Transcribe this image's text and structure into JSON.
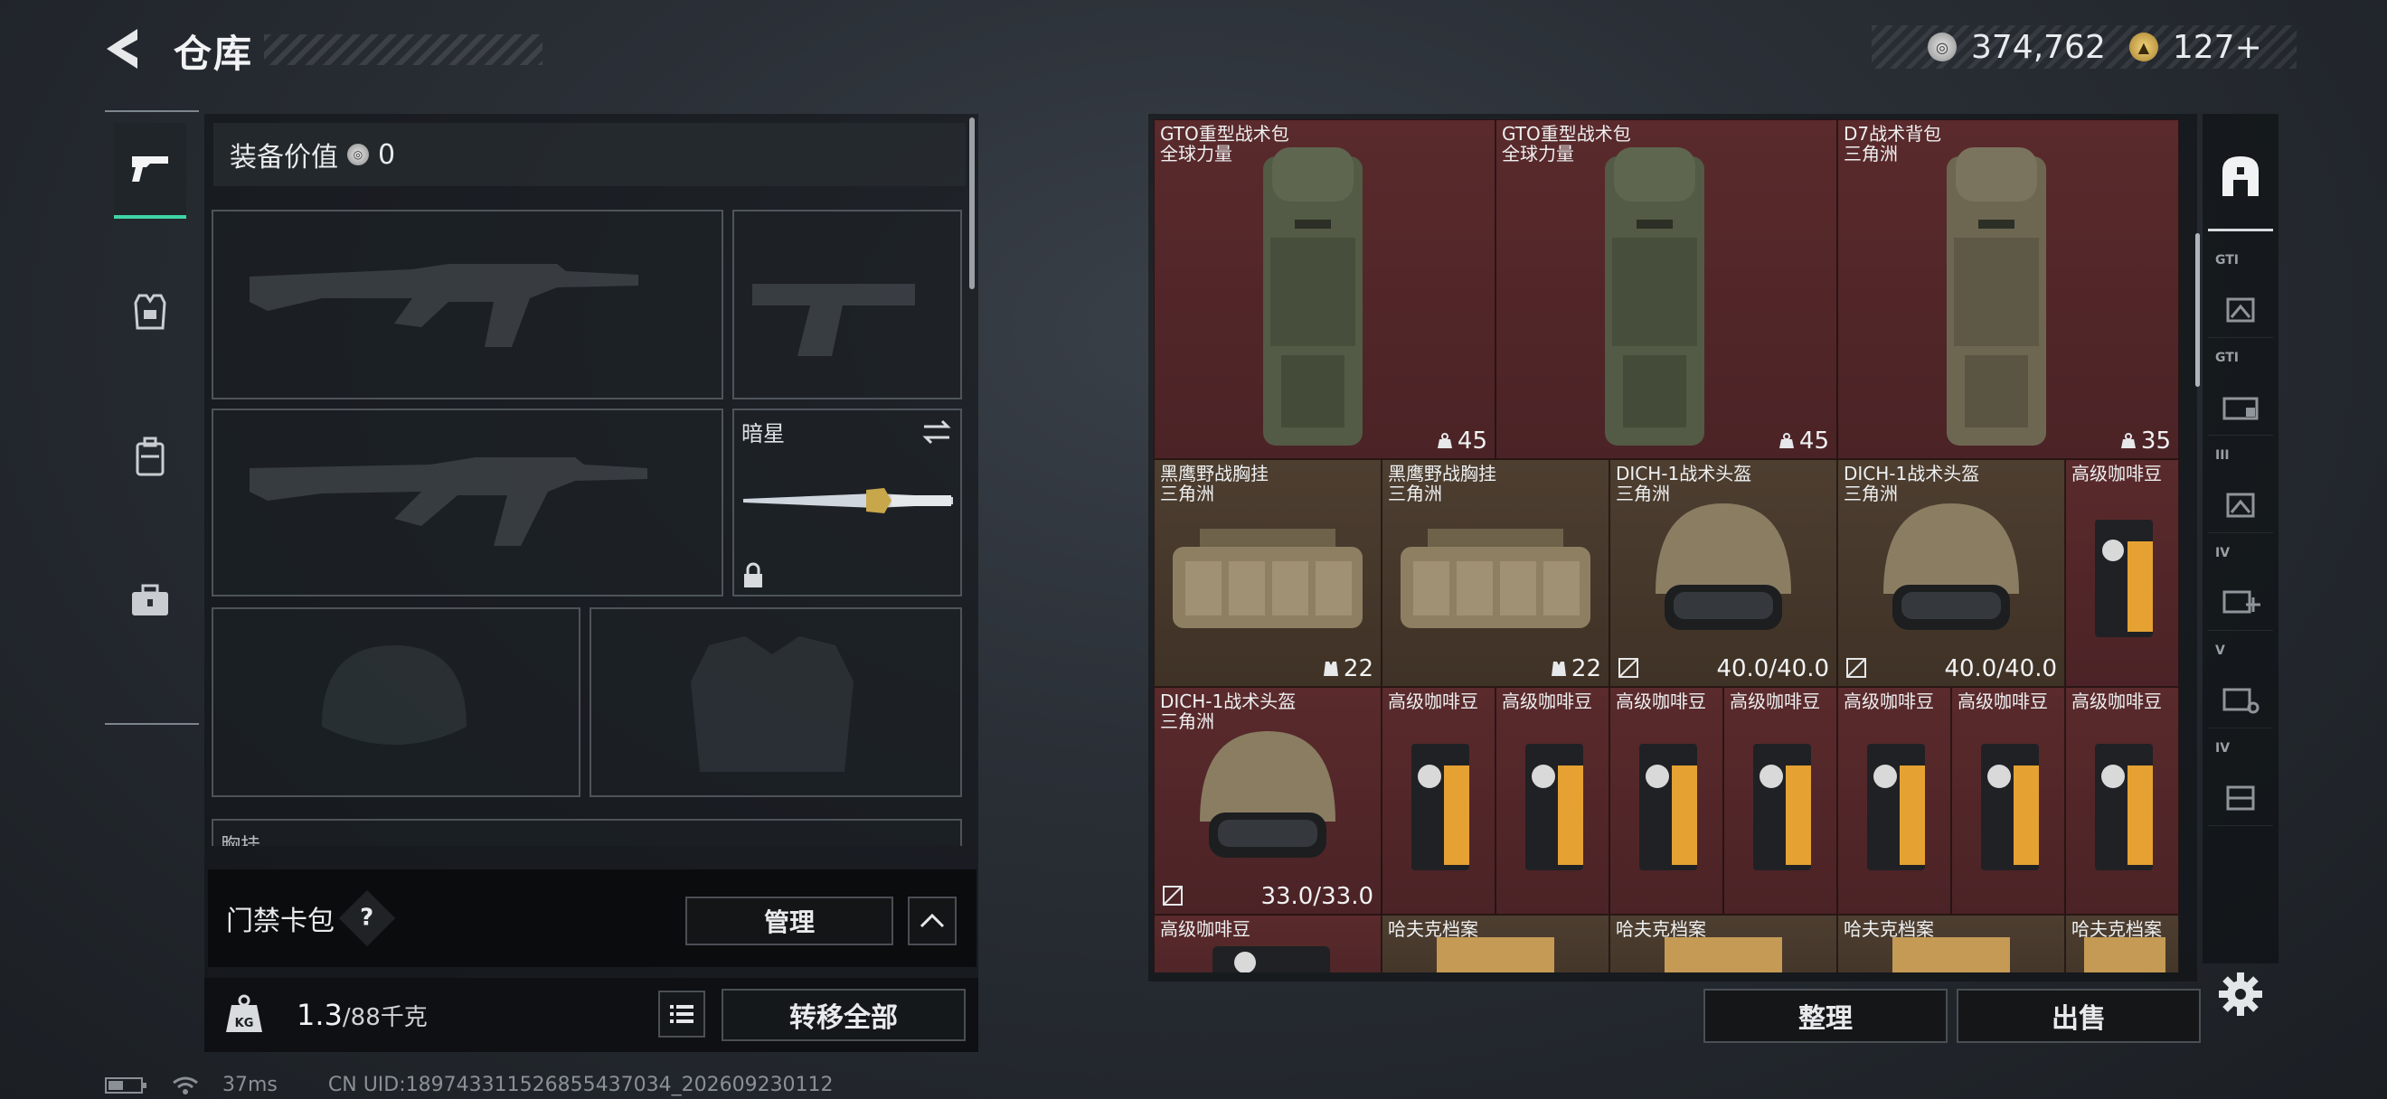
{
  "header": {
    "title": "仓库",
    "silver_amount": "374,762",
    "gold_amount": "127+"
  },
  "left_tabs": [
    {
      "icon": "pistol-icon",
      "active": true
    },
    {
      "icon": "armor-vest-icon",
      "active": false
    },
    {
      "icon": "backpack-icon",
      "active": false
    },
    {
      "icon": "toolbox-icon",
      "active": false
    }
  ],
  "equipment": {
    "value_label": "装备价值",
    "value": "0",
    "melee_name": "暗星",
    "chest_rig_partial": "胸挂"
  },
  "keycard": {
    "label": "门禁卡包",
    "help": "?",
    "manage_label": "管理"
  },
  "capacity": {
    "current": "1.3",
    "max": "/88千克",
    "kg_badge": "KG",
    "transfer_label": "转移全部"
  },
  "status": {
    "ping": "37ms",
    "uid": "CN UID:18974331152685543703​4_202609230112"
  },
  "storage": {
    "row1": [
      {
        "name": "GTO重型战术包",
        "sub": "全球力量",
        "stat": "45"
      },
      {
        "name": "GTO重型战术包",
        "sub": "全球力量",
        "stat": "45"
      },
      {
        "name": "D7战术背包",
        "sub": "三角洲",
        "stat": "35"
      }
    ],
    "row2": [
      {
        "name": "黑鹰野战胸挂",
        "sub": "三角洲",
        "stat": "22"
      },
      {
        "name": "黑鹰野战胸挂",
        "sub": "三角洲",
        "stat": "22"
      },
      {
        "name": "DICH-1战术头盔",
        "sub": "三角洲",
        "stat": "40.0/40.0"
      },
      {
        "name": "DICH-1战术头盔",
        "sub": "三角洲",
        "stat": "40.0/40.0"
      },
      {
        "name": "高级咖啡豆"
      }
    ],
    "row3_helmet": {
      "name": "DICH-1战术头盔",
      "sub": "三角洲",
      "stat": "33.0/33.0"
    },
    "coffee_name": "高级咖啡豆",
    "row4": [
      {
        "name": "高级咖啡豆"
      },
      {
        "name": "哈夫克档案"
      },
      {
        "name": "哈夫克档案"
      },
      {
        "name": "哈夫克档案"
      },
      {
        "name": "哈夫克档案"
      }
    ],
    "sort_label": "整理",
    "sell_label": "出售"
  },
  "right_tabs": [
    "",
    "GTI",
    "GTI",
    "III",
    "IV",
    "V",
    "IV"
  ]
}
